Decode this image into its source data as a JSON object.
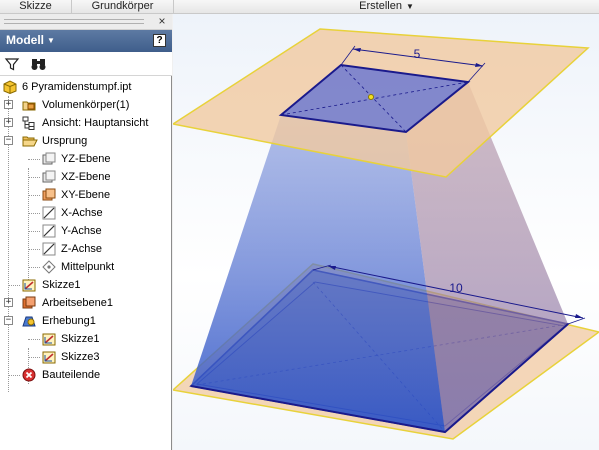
{
  "ribbon": {
    "tabs": [
      {
        "label": "Skizze"
      },
      {
        "label": "Grundkörper"
      },
      {
        "label": "Erstellen"
      }
    ]
  },
  "browser": {
    "panel_title": "Modell",
    "help_label": "?",
    "close_label": "×",
    "tree": [
      {
        "label": "6 Pyramidenstumpf.ipt",
        "icon": "part-icon"
      },
      {
        "label": "Volumenkörper(1)",
        "icon": "solid-bodies-folder-icon"
      },
      {
        "label": "Ansicht: Hauptansicht",
        "icon": "view-icon"
      },
      {
        "label": "Ursprung",
        "icon": "origin-folder-icon"
      },
      {
        "label": "YZ-Ebene",
        "icon": "plane-icon"
      },
      {
        "label": "XZ-Ebene",
        "icon": "plane-icon"
      },
      {
        "label": "XY-Ebene",
        "icon": "plane-highlight-icon"
      },
      {
        "label": "X-Achse",
        "icon": "axis-icon"
      },
      {
        "label": "Y-Achse",
        "icon": "axis-icon"
      },
      {
        "label": "Z-Achse",
        "icon": "axis-icon"
      },
      {
        "label": "Mittelpunkt",
        "icon": "center-point-icon"
      },
      {
        "label": "Skizze1",
        "icon": "sketch-icon"
      },
      {
        "label": "Arbeitsebene1",
        "icon": "work-plane-icon"
      },
      {
        "label": "Erhebung1",
        "icon": "loft-icon"
      },
      {
        "label": "Skizze1",
        "icon": "sketch-icon"
      },
      {
        "label": "Skizze3",
        "icon": "sketch-icon"
      },
      {
        "label": "Bauteilende",
        "icon": "end-of-part-icon"
      }
    ]
  },
  "viewport": {
    "top_dimension": "5",
    "bottom_dimension": "10"
  },
  "colors": {
    "panel_header": "#4a6a96",
    "work_plane": "#f1c9a0",
    "solid_face": "#4a6fd0",
    "edge": "#1a1a8c"
  }
}
